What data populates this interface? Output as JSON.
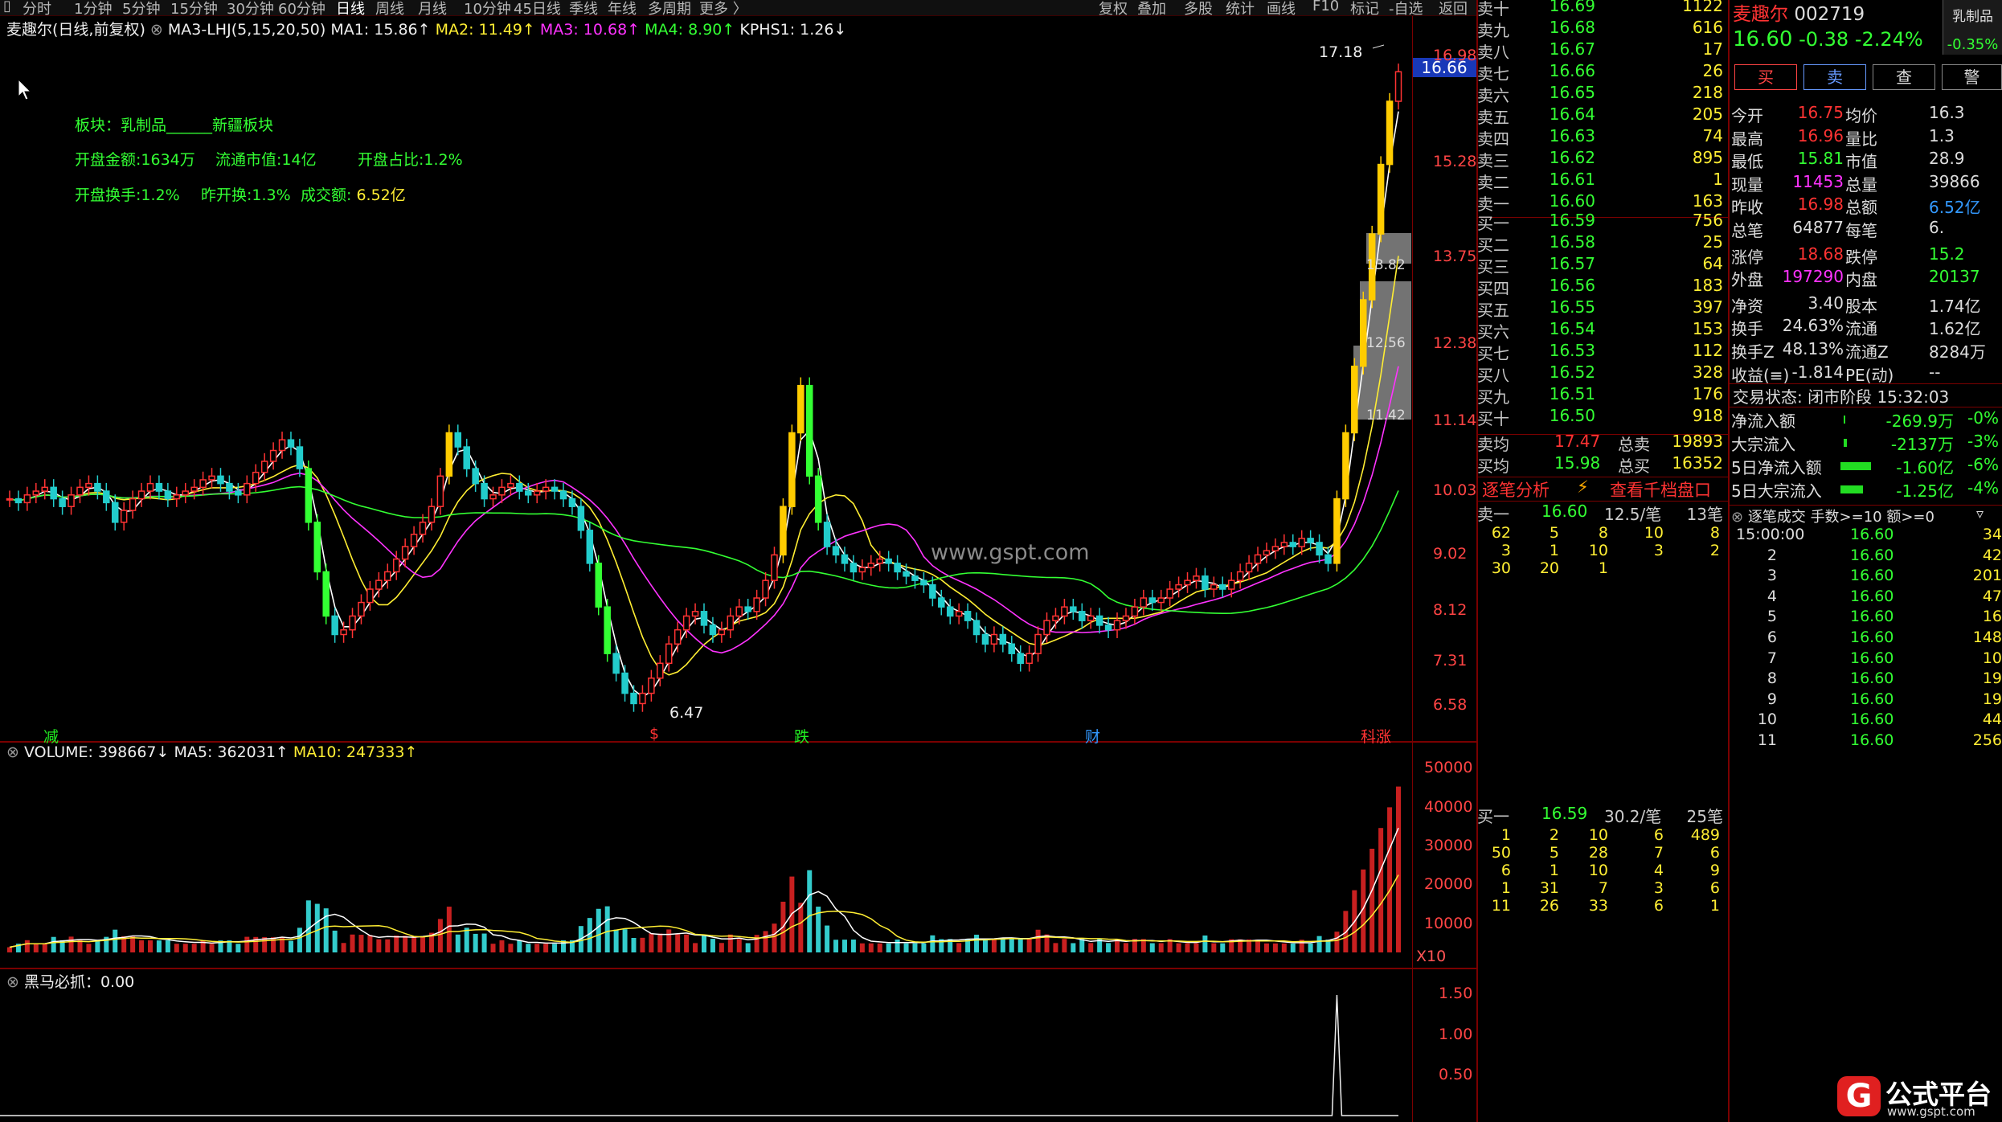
{
  "toolbar": {
    "periods": [
      "分时",
      "1分钟",
      "5分钟",
      "15分钟",
      "30分钟",
      "60分钟",
      "日线",
      "周线",
      "月线",
      "10分钟",
      "45日线",
      "季线",
      "年线",
      "多周期",
      "更多 〉"
    ],
    "active": "日线",
    "tools": [
      "复权",
      "叠加",
      "多股",
      "统计",
      "画线",
      "F10",
      "标记",
      "-自选",
      "返回"
    ],
    "sector_tab": "乳制品"
  },
  "chart": {
    "title": "麦趣尔(日线,前复权)",
    "ma_indicator": "MA3-LHJ(5,15,20,50)",
    "ma1": "MA1: 15.86↑",
    "ma2": "MA2: 11.49↑",
    "ma3": "MA3: 10.68↑",
    "ma4": "MA4: 8.90↑",
    "kphs": "KPHS1: 1.26↓",
    "info_sector": "板块：乳制品______新疆板块",
    "info_open_amt": "开盘金额:1634万",
    "info_float": "流通市值:14亿",
    "info_open_ratio": "开盘占比:1.2%",
    "info_open_turn": "开盘换手:1.2%",
    "info_prev_turn": "昨开换:1.3%",
    "info_turnover": "成交额:",
    "info_turnover_val": "6.52亿",
    "watermark": "www.gspt.com",
    "high_label": "17.18",
    "low_label": "6.47",
    "markers": [
      "减",
      "$",
      "跌",
      "财",
      "科涨"
    ],
    "price_tag": "16.66",
    "y_ticks": [
      "16.98",
      "15.28",
      "13.75",
      "12.38",
      "11.14",
      "10.03",
      "9.02",
      "8.12",
      "7.31",
      "6.58"
    ],
    "vp_labels": [
      "13.82",
      "12.56",
      "11.42"
    ]
  },
  "chart_data": [
    {
      "type": "candlestick",
      "title": "麦趣尔(日线,前复权)",
      "y_ticks": [
        16.98,
        15.28,
        13.75,
        12.38,
        11.14,
        10.03,
        9.02,
        8.12,
        7.31,
        6.58
      ],
      "scale": "log",
      "annotations": {
        "high": 17.18,
        "low": 6.47,
        "last": 16.66
      },
      "series": [
        {
          "name": "MA1",
          "last": 15.86
        },
        {
          "name": "MA2",
          "last": 11.49
        },
        {
          "name": "MA3",
          "last": 10.68
        },
        {
          "name": "MA4",
          "last": 8.9
        }
      ],
      "closes": [
        8.9,
        8.85,
        8.95,
        9.0,
        9.05,
        8.9,
        8.8,
        8.95,
        9.05,
        9.1,
        9.0,
        8.85,
        8.6,
        8.75,
        8.9,
        9.0,
        9.1,
        9.0,
        8.9,
        8.95,
        9.0,
        9.05,
        9.15,
        9.2,
        9.1,
        9.0,
        8.95,
        9.1,
        9.25,
        9.4,
        9.55,
        9.7,
        9.6,
        9.3,
        8.6,
        8.0,
        7.5,
        7.3,
        7.35,
        7.5,
        7.65,
        7.8,
        7.9,
        8.0,
        8.15,
        8.3,
        8.45,
        8.6,
        8.8,
        9.2,
        9.8,
        9.6,
        9.3,
        9.1,
        8.9,
        8.95,
        9.05,
        9.1,
        9.0,
        8.95,
        9.0,
        9.05,
        9.0,
        8.9,
        8.8,
        8.5,
        8.1,
        7.6,
        7.1,
        6.9,
        6.7,
        6.6,
        6.7,
        6.85,
        7.0,
        7.2,
        7.35,
        7.5,
        7.55,
        7.4,
        7.3,
        7.35,
        7.5,
        7.6,
        7.55,
        7.7,
        7.9,
        8.2,
        8.8,
        9.8,
        10.5,
        9.2,
        8.6,
        8.3,
        8.2,
        8.1,
        8.0,
        8.05,
        8.1,
        8.15,
        8.1,
        8.0,
        7.95,
        7.9,
        7.85,
        7.7,
        7.6,
        7.5,
        7.55,
        7.45,
        7.3,
        7.2,
        7.3,
        7.2,
        7.1,
        7.0,
        7.1,
        7.3,
        7.45,
        7.5,
        7.6,
        7.55,
        7.45,
        7.5,
        7.4,
        7.35,
        7.45,
        7.5,
        7.6,
        7.7,
        7.65,
        7.7,
        7.8,
        7.85,
        7.9,
        7.95,
        7.8,
        7.85,
        7.8,
        7.9,
        8.0,
        8.1,
        8.2,
        8.25,
        8.3,
        8.35,
        8.3,
        8.4,
        8.35,
        8.2,
        8.1,
        8.9,
        9.8,
        10.8,
        11.9,
        13.1,
        14.5,
        15.9,
        16.6
      ]
    },
    {
      "type": "bar",
      "title": "VOLUME",
      "y_ticks": [
        50000,
        40000,
        30000,
        20000,
        10000
      ],
      "unit": "X10",
      "series": [
        {
          "name": "VOLUME",
          "last": 398667
        },
        {
          "name": "MA5",
          "last": 362031
        },
        {
          "name": "MA10",
          "last": 247333
        }
      ]
    },
    {
      "type": "line",
      "title": "黑马必抓",
      "y_ticks": [
        1.5,
        1.0,
        0.5
      ],
      "series": [
        {
          "name": "黑马必抓",
          "last": 0.0
        }
      ]
    }
  ],
  "volume": {
    "label": "VOLUME: 398667↓",
    "ma5": "MA5: 362031↑",
    "ma10": "MA10: 247333↑",
    "ticks": [
      "50000",
      "40000",
      "30000",
      "20000",
      "10000"
    ],
    "unit": "X10"
  },
  "indicator": {
    "label": "黑马必抓：0.00",
    "ticks": [
      "1.50",
      "1.00",
      "0.50"
    ]
  },
  "orderbook": {
    "sells": [
      {
        "n": "卖十",
        "p": "16.69",
        "v": "1122"
      },
      {
        "n": "卖九",
        "p": "16.68",
        "v": "616"
      },
      {
        "n": "卖八",
        "p": "16.67",
        "v": "17"
      },
      {
        "n": "卖七",
        "p": "16.66",
        "v": "26"
      },
      {
        "n": "卖六",
        "p": "16.65",
        "v": "218"
      },
      {
        "n": "卖五",
        "p": "16.64",
        "v": "205"
      },
      {
        "n": "卖四",
        "p": "16.63",
        "v": "74"
      },
      {
        "n": "卖三",
        "p": "16.62",
        "v": "895"
      },
      {
        "n": "卖二",
        "p": "16.61",
        "v": "1"
      },
      {
        "n": "卖一",
        "p": "16.60",
        "v": "163"
      }
    ],
    "buys": [
      {
        "n": "买一",
        "p": "16.59",
        "v": "756"
      },
      {
        "n": "买二",
        "p": "16.58",
        "v": "25"
      },
      {
        "n": "买三",
        "p": "16.57",
        "v": "64"
      },
      {
        "n": "买四",
        "p": "16.56",
        "v": "183"
      },
      {
        "n": "买五",
        "p": "16.55",
        "v": "397"
      },
      {
        "n": "买六",
        "p": "16.54",
        "v": "153"
      },
      {
        "n": "买七",
        "p": "16.53",
        "v": "112"
      },
      {
        "n": "买八",
        "p": "16.52",
        "v": "328"
      },
      {
        "n": "买九",
        "p": "16.51",
        "v": "176"
      },
      {
        "n": "买十",
        "p": "16.50",
        "v": "918"
      }
    ],
    "avg_sell_l": "卖均",
    "avg_sell": "17.47",
    "total_sell_l": "总卖",
    "total_sell": "19893",
    "avg_buy_l": "买均",
    "avg_buy": "15.98",
    "total_buy_l": "总买",
    "total_buy": "16352"
  },
  "tick": {
    "title": "逐笔分析",
    "link": "查看千档盘口",
    "s1_label": "卖一",
    "s1_price": "16.60",
    "s1_avg": "12.5/笔",
    "s1_count": "13笔",
    "s1_rows": [
      [
        "62",
        "5",
        "8",
        "10",
        "8"
      ],
      [
        "3",
        "1",
        "10",
        "3",
        "2"
      ],
      [
        "30",
        "20",
        "1",
        "",
        ""
      ]
    ],
    "b1_label": "买一",
    "b1_price": "16.59",
    "b1_avg": "30.2/笔",
    "b1_count": "25笔",
    "b1_rows": [
      [
        "1",
        "2",
        "10",
        "6",
        "489"
      ],
      [
        "50",
        "5",
        "28",
        "7",
        "6"
      ],
      [
        "6",
        "1",
        "10",
        "4",
        "9"
      ],
      [
        "1",
        "31",
        "7",
        "3",
        "6"
      ],
      [
        "11",
        "26",
        "33",
        "6",
        "1"
      ]
    ]
  },
  "stock": {
    "name": "麦趣尔",
    "code": "002719",
    "price": "16.60",
    "change": "-0.38",
    "pct": "-2.24%",
    "side_pct": "-0.35%",
    "buy": "买",
    "sell": "卖",
    "check": "查",
    "alert": "警",
    "stats": [
      [
        "今开",
        "16.75",
        "均价",
        "16.3"
      ],
      [
        "最高",
        "16.96",
        "量比",
        "1.3"
      ],
      [
        "最低",
        "15.81",
        "市值",
        "28.9"
      ],
      [
        "现量",
        "11453",
        "总量",
        "39866"
      ],
      [
        "昨收",
        "16.98",
        "总额",
        "6.52亿"
      ],
      [
        "总笔",
        "64877",
        "每笔",
        "6."
      ],
      [
        "涨停",
        "18.68",
        "跌停",
        "15.2"
      ],
      [
        "外盘",
        "197290",
        "内盘",
        "20137"
      ],
      [
        "净资",
        "3.40",
        "股本",
        "1.74亿"
      ],
      [
        "换手",
        "24.63%",
        "流通",
        "1.62亿"
      ],
      [
        "换手Z",
        "48.13%",
        "流通Z",
        "8284万"
      ],
      [
        "收益(≡)",
        "-1.814",
        "PE(动)",
        "--"
      ]
    ],
    "trade_status": "交易状态: 闭市阶段 15:32:03",
    "flows": [
      [
        "净流入额",
        "-269.9万",
        "-0%"
      ],
      [
        "大宗流入",
        "-2137万",
        "-3%"
      ],
      [
        "5日净流入额",
        "-1.60亿",
        "-6%"
      ],
      [
        "5日大宗流入",
        "-1.25亿",
        "-4%"
      ]
    ]
  },
  "trades": {
    "title": "逐笔成交",
    "filter": "手数>=10 额>=0",
    "rows": [
      [
        "15:00:00",
        "16.60",
        "34"
      ],
      [
        "2",
        "16.60",
        "42"
      ],
      [
        "3",
        "16.60",
        "201"
      ],
      [
        "4",
        "16.60",
        "47"
      ],
      [
        "5",
        "16.60",
        "16"
      ],
      [
        "6",
        "16.60",
        "148"
      ],
      [
        "7",
        "16.60",
        "10"
      ],
      [
        "8",
        "16.60",
        "19"
      ],
      [
        "9",
        "16.60",
        "19"
      ],
      [
        "10",
        "16.60",
        "44"
      ],
      [
        "11",
        "16.60",
        "256"
      ]
    ]
  },
  "brand": {
    "name": "公式平台",
    "url": "www.gspt.com",
    "logo": "G"
  }
}
